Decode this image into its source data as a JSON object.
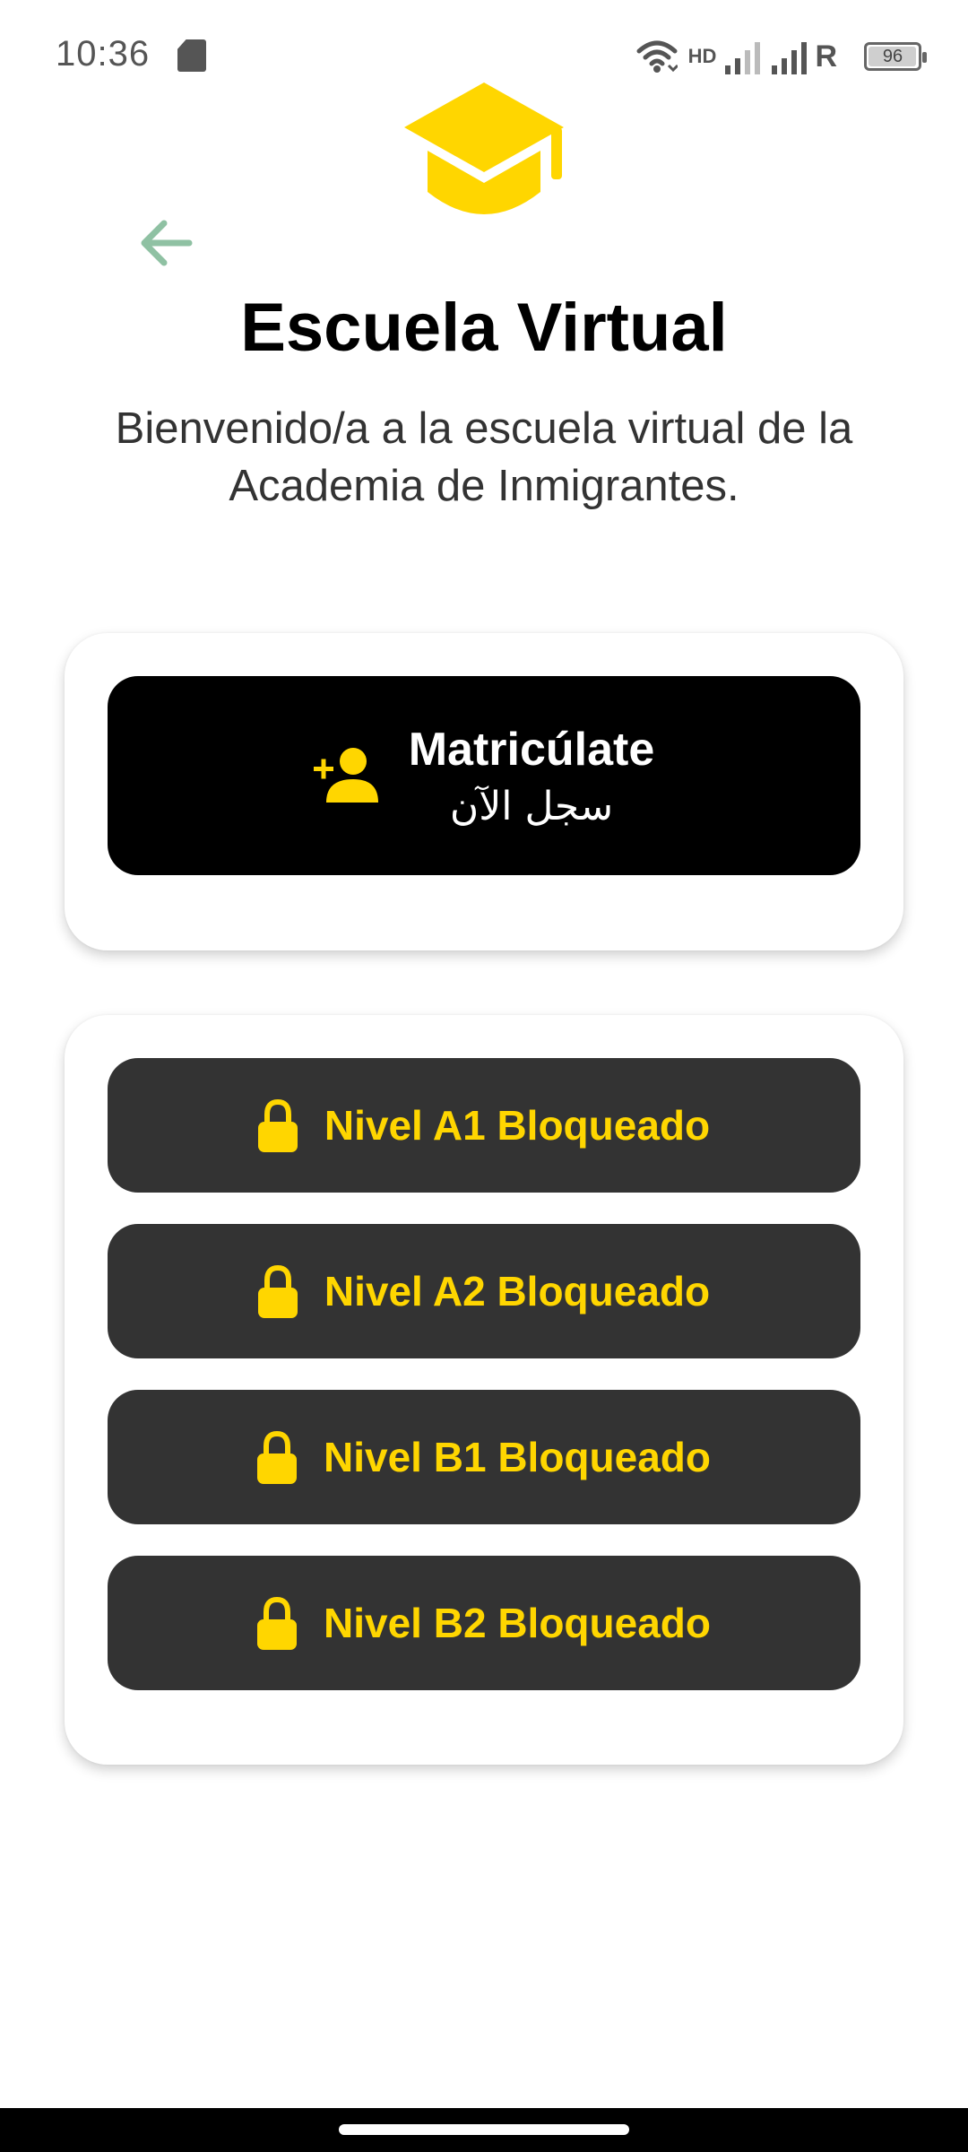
{
  "status_bar": {
    "time": "10:36",
    "network_label": "HD",
    "roaming_label": "R",
    "battery_level": "96",
    "icons": [
      "sd-card-icon",
      "wifi-icon",
      "signal-icon",
      "battery-icon"
    ]
  },
  "header": {
    "logo_icon": "graduation-cap-icon",
    "back_icon": "arrow-left-icon",
    "title": "Escuela Virtual",
    "subtitle": "Bienvenido/a a la escuela virtual de la Academia de Inmigrantes."
  },
  "enroll": {
    "icon": "add-user-icon",
    "label": "Matricúlate",
    "sublabel": "سجل الآن"
  },
  "levels": [
    {
      "label": "Nivel A1 Bloqueado",
      "icon": "lock-icon"
    },
    {
      "label": "Nivel A2 Bloqueado",
      "icon": "lock-icon"
    },
    {
      "label": "Nivel B1 Bloqueado",
      "icon": "lock-icon"
    },
    {
      "label": "Nivel B2 Bloqueado",
      "icon": "lock-icon"
    }
  ],
  "colors": {
    "accent": "#FFD600",
    "back_arrow": "#8FC1A3",
    "button_dark": "#333333",
    "enroll_button": "#000000"
  }
}
